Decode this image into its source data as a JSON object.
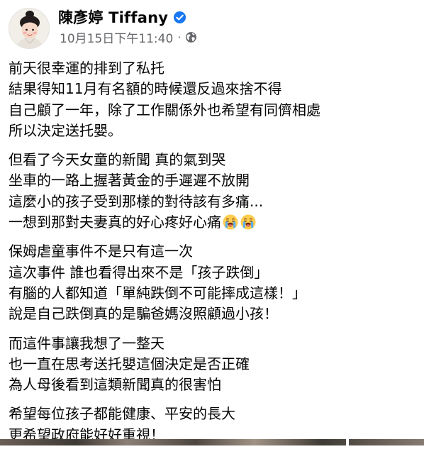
{
  "post": {
    "author": "陳彥婷 Tiffany",
    "verified_icon": "verified-badge-icon",
    "timestamp": "10月15日下午11:40",
    "separator": "·",
    "audience_icon": "globe-icon",
    "paragraphs": [
      [
        "前天很幸運的排到了私托",
        "結果得知11月有名額的時候還反過來捨不得",
        "自己顧了一年，除了工作關係外也希望有同儕相處",
        "所以決定送托嬰。"
      ],
      [
        "但看了今天女童的新聞 真的氣到哭",
        "坐車的一路上握著黃金的手遲遲不放開",
        "這麼小的孩子受到那樣的對待該有多痛...",
        "一想到那對夫妻真的好心疼好心痛"
      ],
      [
        "保姆虐童事件不是只有這一次",
        "這次事件 誰也看得出來不是「孩子跌倒」",
        "有腦的人都知道「單純跌倒不可能摔成這樣！」",
        "說是自己跌倒真的是騙爸媽沒照顧過小孩！"
      ],
      [
        "而這件事讓我想了一整天",
        "也一直在思考送托嬰這個決定是否正確",
        "為人母後看到這類新聞真的很害怕"
      ],
      [
        "希望每位孩子都能健康、平安的長大",
        "更希望政府能好好重視！"
      ]
    ],
    "emoji": [
      "loudly-crying-face-icon",
      "loudly-crying-face-icon"
    ]
  },
  "colors": {
    "text": "#050505",
    "meta": "#65676b",
    "verified": "#1877f2"
  }
}
